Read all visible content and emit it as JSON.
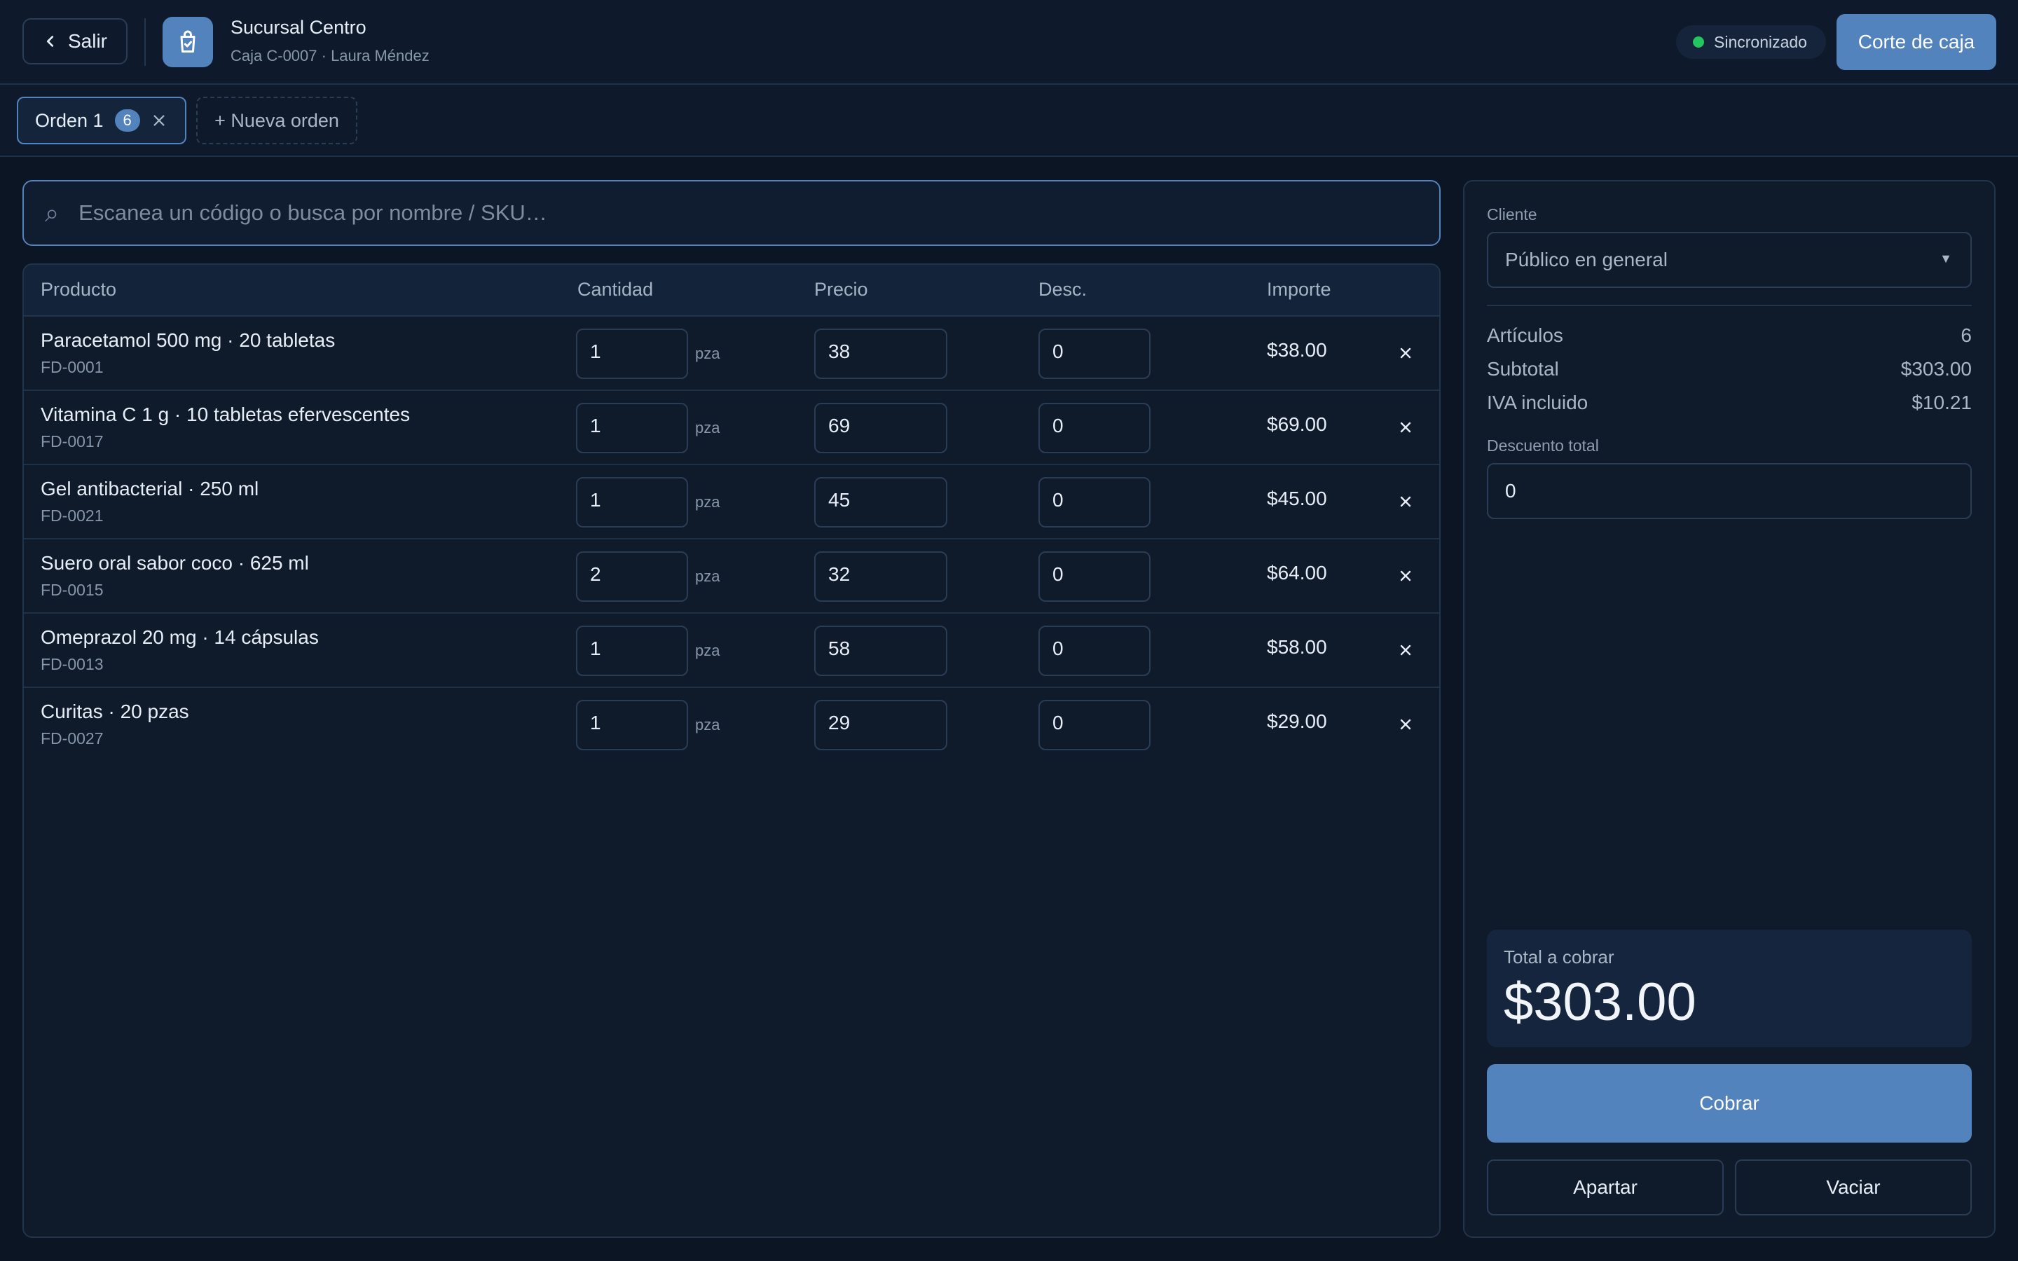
{
  "header": {
    "back_label": "Salir",
    "store_name": "Sucursal Centro",
    "store_sub": "Caja C-0007 · Laura Méndez",
    "sync_status": "Sincronizado",
    "sync_color": "#22c55e",
    "corte_label": "Corte de caja",
    "accent": "#5283bd"
  },
  "tabs": {
    "orders": [
      {
        "label": "Orden 1",
        "count": "6"
      }
    ],
    "new_order_label": "+ Nueva orden"
  },
  "search": {
    "icon": "⌕",
    "placeholder": "Escanea un código o busca por nombre / SKU…"
  },
  "table": {
    "columns": [
      "Producto",
      "Cantidad",
      "Precio",
      "Desc.",
      "Importe"
    ],
    "rows": [
      {
        "name": "Paracetamol 500 mg · 20 tabletas",
        "sku": "FD-0001",
        "qty": "1",
        "unit": "pza",
        "price": "38",
        "disc": "0",
        "amount": "$38.00"
      },
      {
        "name": "Vitamina C 1 g · 10 tabletas efervescentes",
        "sku": "FD-0017",
        "qty": "1",
        "unit": "pza",
        "price": "69",
        "disc": "0",
        "amount": "$69.00"
      },
      {
        "name": "Gel antibacterial · 250 ml",
        "sku": "FD-0021",
        "qty": "1",
        "unit": "pza",
        "price": "45",
        "disc": "0",
        "amount": "$45.00"
      },
      {
        "name": "Suero oral sabor coco · 625 ml",
        "sku": "FD-0015",
        "qty": "2",
        "unit": "pza",
        "price": "32",
        "disc": "0",
        "amount": "$64.00"
      },
      {
        "name": "Omeprazol 20 mg · 14 cápsulas",
        "sku": "FD-0013",
        "qty": "1",
        "unit": "pza",
        "price": "58",
        "disc": "0",
        "amount": "$58.00"
      },
      {
        "name": "Curitas · 20 pzas",
        "sku": "FD-0027",
        "qty": "1",
        "unit": "pza",
        "price": "29",
        "disc": "0",
        "amount": "$29.00"
      }
    ]
  },
  "summary": {
    "client_label": "Cliente",
    "client_value": "Público en general",
    "articles_label": "Artículos",
    "articles_value": "6",
    "subtotal_label": "Subtotal",
    "subtotal_value": "$303.00",
    "iva_label": "IVA incluido",
    "iva_value": "$10.21",
    "discount_label": "Descuento total",
    "discount_value": "0",
    "total_label": "Total a cobrar",
    "total_value": "$303.00",
    "cobrar_label": "Cobrar",
    "apartar_label": "Apartar",
    "vaciar_label": "Vaciar"
  }
}
